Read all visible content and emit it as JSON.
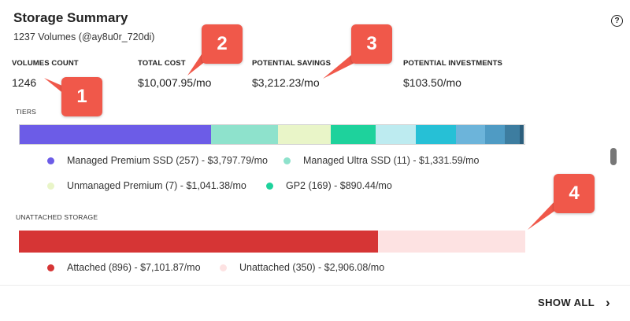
{
  "card": {
    "title": "Storage Summary",
    "subtitle": "1237 Volumes (@ay8u0r_720di)",
    "help_glyph": "?"
  },
  "metrics": [
    {
      "label": "VOLUMES COUNT",
      "value": "1246"
    },
    {
      "label": "TOTAL COST",
      "value": "$10,007.95/mo"
    },
    {
      "label": "POTENTIAL SAVINGS",
      "value": "$3,212.23/mo"
    },
    {
      "label": "POTENTIAL INVESTMENTS",
      "value": "$103.50/mo"
    }
  ],
  "tiers": {
    "label": "TIERS",
    "segments": [
      {
        "fraction": 0.379,
        "color": "#6c5ce7"
      },
      {
        "fraction": 0.133,
        "color": "#8ee2cc"
      },
      {
        "fraction": 0.104,
        "color": "#e9f5c8"
      },
      {
        "fraction": 0.089,
        "color": "#1ed29c"
      },
      {
        "fraction": 0.079,
        "color": "#bdebf0"
      },
      {
        "fraction": 0.08,
        "color": "#26c0d6"
      },
      {
        "fraction": 0.058,
        "color": "#6cb4da"
      },
      {
        "fraction": 0.039,
        "color": "#4f9bc4"
      },
      {
        "fraction": 0.03,
        "color": "#3d7da0"
      },
      {
        "fraction": 0.007,
        "color": "#2c5e7c"
      }
    ],
    "legend": [
      {
        "label": "Managed Premium SSD (257) - $3,797.79/mo",
        "color": "#6c5ce7"
      },
      {
        "label": "Managed Ultra SSD (11) - $1,331.59/mo",
        "color": "#8ee2cc"
      },
      {
        "label": "Unmanaged Premium (7) - $1,041.38/mo",
        "color": "#e9f5c8"
      },
      {
        "label": "GP2 (169) - $890.44/mo",
        "color": "#1ed29c"
      }
    ]
  },
  "unattached": {
    "label": "UNATTACHED STORAGE",
    "segments": [
      {
        "fraction": 0.7096,
        "color": "#d63535"
      },
      {
        "fraction": 0.2904,
        "color": "#fde2e2"
      }
    ],
    "legend": [
      {
        "label": "Attached (896) - $7,101.87/mo",
        "color": "#d63535"
      },
      {
        "label": "Unattached (350) - $2,906.08/mo",
        "color": "#fde2e2"
      }
    ]
  },
  "footer": {
    "show_all_label": "SHOW ALL",
    "chevron_glyph": "›"
  },
  "annotations": [
    "1",
    "2",
    "3",
    "4"
  ]
}
